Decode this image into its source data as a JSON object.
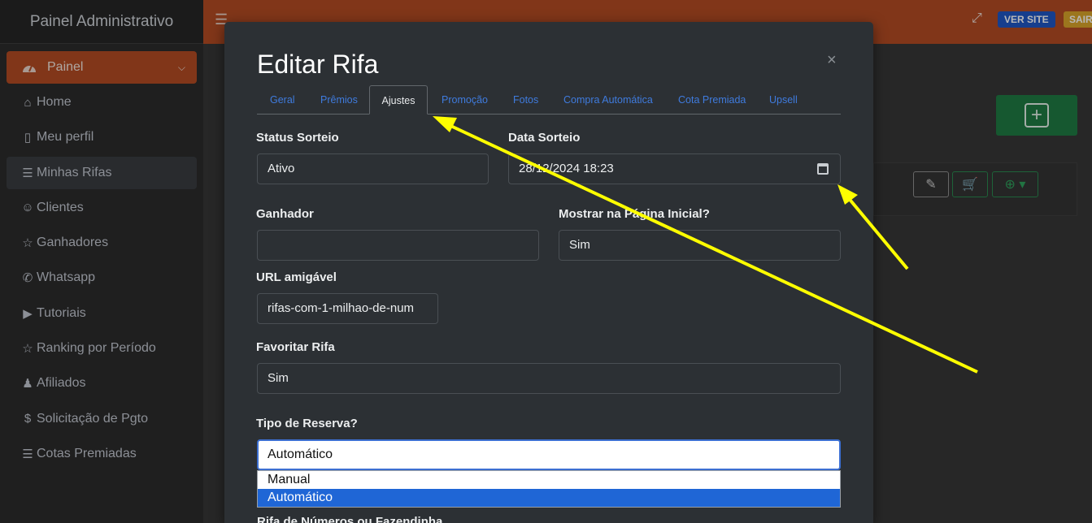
{
  "sidebar": {
    "brand": "Painel Administrativo",
    "active": {
      "label": "Painel",
      "icon": "dashboard-gauge-icon"
    },
    "items": [
      {
        "label": "Home",
        "icon": "home-icon",
        "glyph": "⌂"
      },
      {
        "label": "Meu perfil",
        "icon": "id-badge-icon",
        "glyph": "▯"
      },
      {
        "label": "Minhas Rifas",
        "icon": "ticket-list-icon",
        "glyph": "☰"
      },
      {
        "label": "Clientes",
        "icon": "users-icon",
        "glyph": "👥"
      },
      {
        "label": "Ganhadores",
        "icon": "trophy-icon",
        "glyph": "🏆"
      },
      {
        "label": "Whatsapp",
        "icon": "whatsapp-icon",
        "glyph": "◯"
      },
      {
        "label": "Tutoriais",
        "icon": "video-camera-icon",
        "glyph": "▶"
      },
      {
        "label": "Ranking por Período",
        "icon": "trophy-icon",
        "glyph": "🏆"
      },
      {
        "label": "Afiliados",
        "icon": "user-plus-icon",
        "glyph": "👤"
      },
      {
        "label": "Solicitação de Pgto",
        "icon": "dollar-icon",
        "glyph": "$"
      },
      {
        "label": "Cotas Premiadas",
        "icon": "ticket-list-icon",
        "glyph": "☰"
      }
    ]
  },
  "header": {
    "ver_site": "VER SITE",
    "sair": "SAIR"
  },
  "modal": {
    "title": "Editar Rifa",
    "close": "×",
    "tabs": [
      "Geral",
      "Prêmios",
      "Ajustes",
      "Promoção",
      "Fotos",
      "Compra Automática",
      "Cota Premiada",
      "Upsell"
    ],
    "active_tab": "Ajustes",
    "fields": {
      "status_label": "Status Sorteio",
      "status_value": "Ativo",
      "data_label": "Data Sorteio",
      "data_value": "28/12/2024 18:23",
      "ganhador_label": "Ganhador",
      "ganhador_value": "",
      "mostrar_label": "Mostrar na Página Inicial?",
      "mostrar_value": "Sim",
      "url_label": "URL amigável",
      "url_value": "rifas-com-1-milhao-de-num",
      "favoritar_label": "Favoritar Rifa",
      "favoritar_value": "Sim",
      "reserva_label": "Tipo de Reserva?",
      "reserva_value": "Automático",
      "reserva_options": [
        "Manual",
        "Automático"
      ],
      "next_label": "Rifa de Números ou Fazendinha"
    }
  },
  "colors": {
    "accent": "#b34b23",
    "modal_bg": "#2c3034",
    "annotation": "#ffff00",
    "link": "#3f7bde",
    "success": "#1f7a43"
  }
}
